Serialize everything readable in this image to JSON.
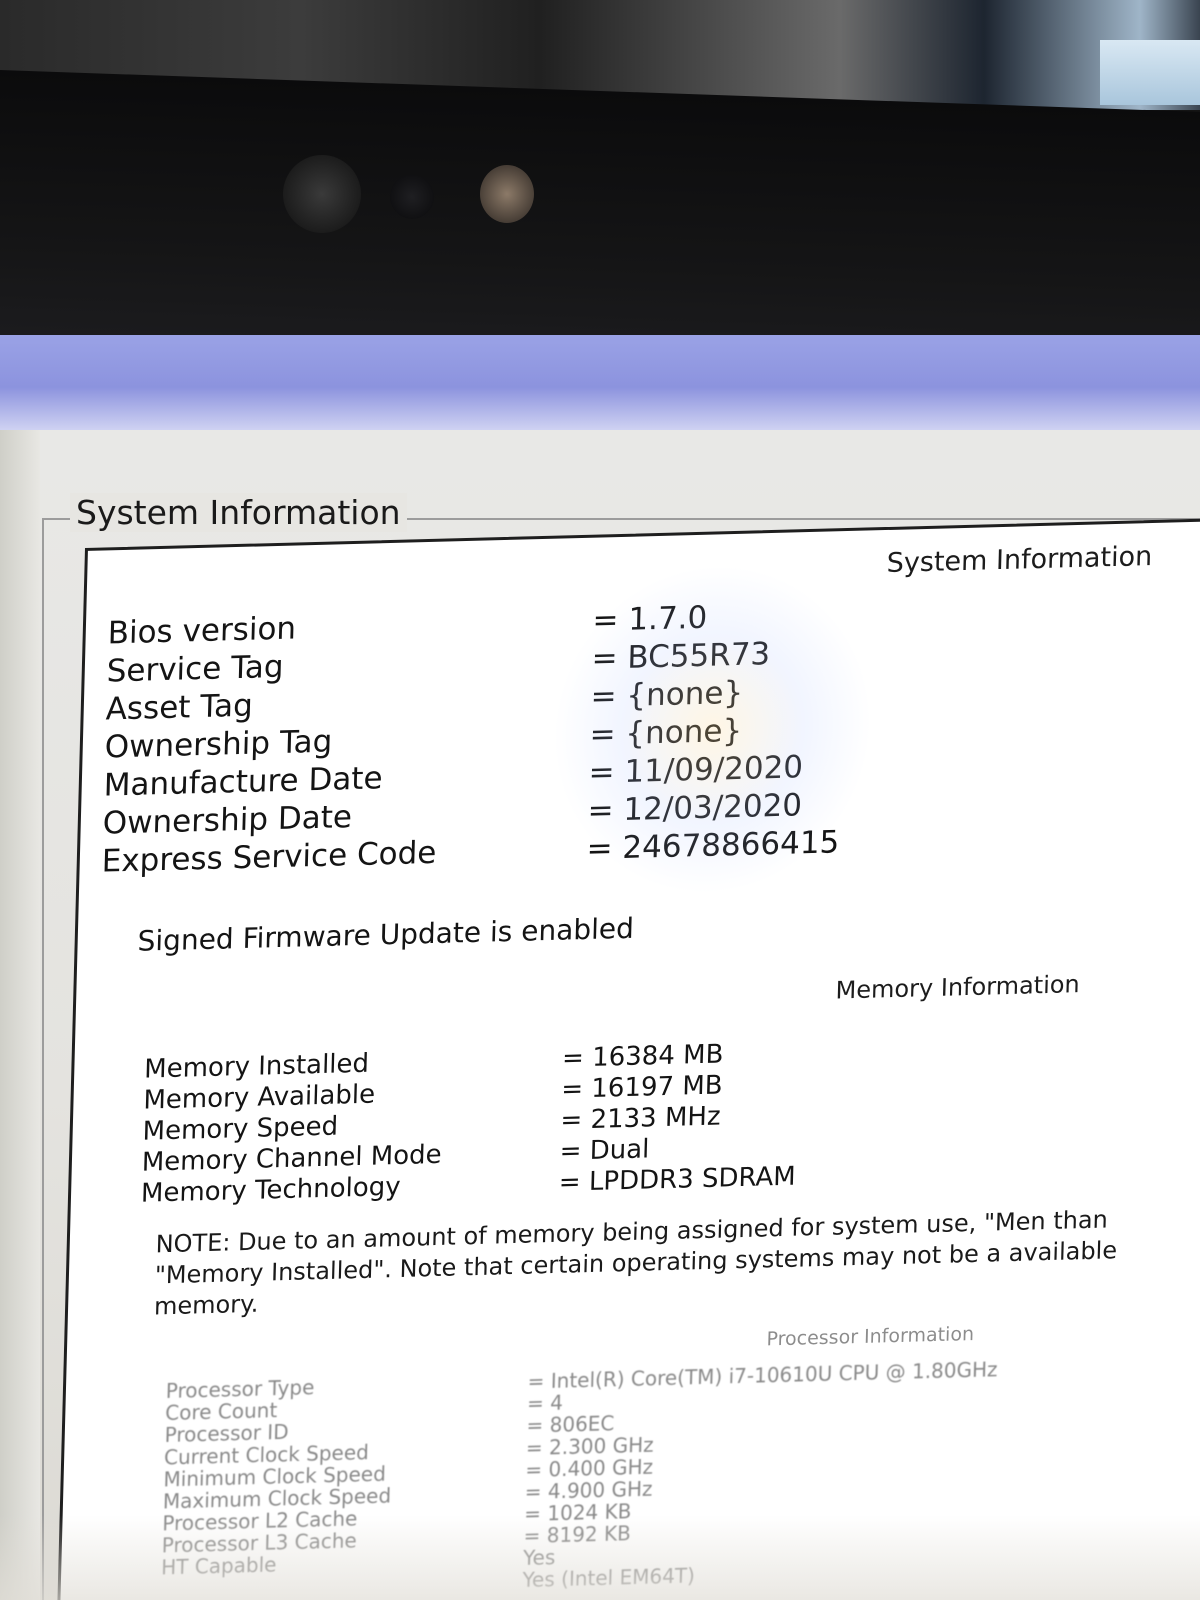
{
  "window": {
    "group_title": "System Information"
  },
  "system": {
    "heading": "System Information",
    "rows": [
      {
        "label": "Bios version",
        "value": "= 1.7.0"
      },
      {
        "label": "Service Tag",
        "value": "= BC55R73"
      },
      {
        "label": "Asset Tag",
        "value": "= {none}"
      },
      {
        "label": "Ownership Tag",
        "value": "= {none}"
      },
      {
        "label": "Manufacture Date",
        "value": "= 11/09/2020"
      },
      {
        "label": "Ownership Date",
        "value": "= 12/03/2020"
      },
      {
        "label": "Express Service Code",
        "value": "= 24678866415"
      }
    ],
    "signed_firmware": "Signed Firmware Update is enabled"
  },
  "memory": {
    "heading": "Memory Information",
    "rows": [
      {
        "label": "Memory Installed",
        "value": "= 16384 MB"
      },
      {
        "label": "Memory Available",
        "value": "= 16197 MB"
      },
      {
        "label": "Memory Speed",
        "value": "= 2133 MHz"
      },
      {
        "label": "Memory Channel Mode",
        "value": "= Dual"
      },
      {
        "label": "Memory Technology",
        "value": "= LPDDR3 SDRAM"
      }
    ],
    "note": "NOTE: Due to an amount of memory being assigned for system use, \"Men than \"Memory Installed\". Note that certain operating systems may not be a available memory."
  },
  "processor": {
    "heading": "Processor Information",
    "rows": [
      {
        "label": "Processor Type",
        "value": "= Intel(R) Core(TM) i7-10610U CPU @ 1.80GHz"
      },
      {
        "label": "Core Count",
        "value": "= 4"
      },
      {
        "label": "Processor ID",
        "value": "= 806EC"
      },
      {
        "label": "Current Clock Speed",
        "value": "= 2.300 GHz"
      },
      {
        "label": "Minimum Clock Speed",
        "value": "= 0.400 GHz"
      },
      {
        "label": "Maximum Clock Speed",
        "value": "= 4.900 GHz"
      },
      {
        "label": "Processor L2 Cache",
        "value": "= 1024 KB"
      },
      {
        "label": "Processor L3 Cache",
        "value": "= 8192 KB"
      },
      {
        "label": "HT Capable",
        "value": "Yes"
      },
      {
        "label": "",
        "value": "Yes (Intel EM64T)"
      }
    ]
  }
}
